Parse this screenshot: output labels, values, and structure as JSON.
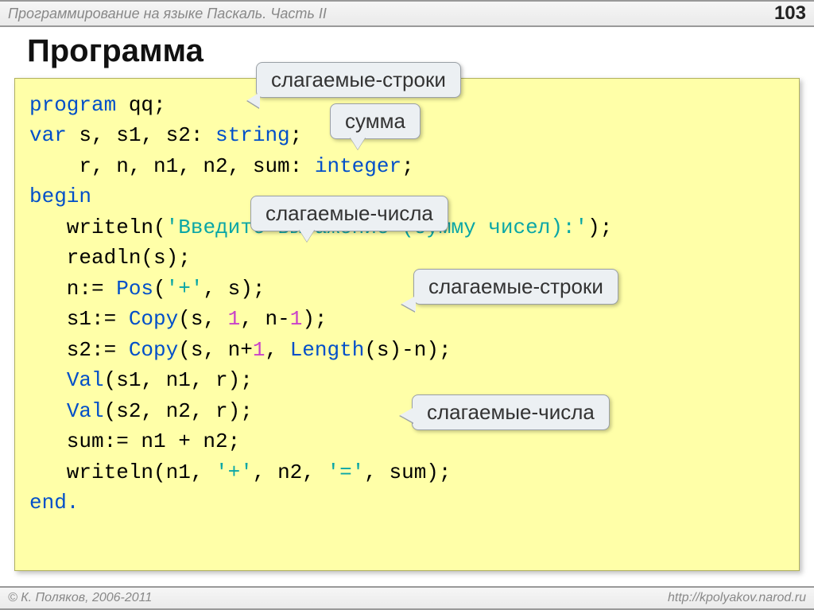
{
  "header": {
    "title": "Программирование на языке Паскаль. Часть II",
    "page_number": "103"
  },
  "slide_title": "Программа",
  "callouts": {
    "c1": "слагаемые-строки",
    "c2": "сумма",
    "c3": "слагаемые-числа",
    "c4": "слагаемые-строки",
    "c5": "слагаемые-числа"
  },
  "code": {
    "l1a": "program",
    "l1b": " qq;",
    "l2a": "var",
    "l2b": " s, s1, s2: ",
    "l2c": "string",
    "l2d": ";",
    "l3a": "    r, n, n1, n2, sum: ",
    "l3b": "integer",
    "l3c": ";",
    "l4": "begin",
    "l5a": "   writeln(",
    "l5b": "'Введите выражение (сумму чисел):'",
    "l5c": ");",
    "l6": "   readln(s);",
    "l7a": "   n:= ",
    "l7b": "Pos",
    "l7c": "(",
    "l7d": "'+'",
    "l7e": ", s);",
    "l8a": "   s1:= ",
    "l8b": "Copy",
    "l8c": "(s, ",
    "l8d": "1",
    "l8e": ", n-",
    "l8f": "1",
    "l8g": ");",
    "l9a": "   s2:= ",
    "l9b": "Copy",
    "l9c": "(s, n+",
    "l9d": "1",
    "l9e": ", ",
    "l9f": "Length",
    "l9g": "(s)-n);",
    "l10a": "   ",
    "l10b": "Val",
    "l10c": "(s1, n1, r);",
    "l11a": "   ",
    "l11b": "Val",
    "l11c": "(s2, n2, r);",
    "l12a": "   sum:= n1 + n2;",
    "l13a": "   writeln(n1, ",
    "l13b": "'+'",
    "l13c": ", n2, ",
    "l13d": "'='",
    "l13e": ", sum);",
    "l14": "end."
  },
  "footer": {
    "copyright": "© К. Поляков, 2006-2011",
    "url": "http://kpolyakov.narod.ru"
  }
}
